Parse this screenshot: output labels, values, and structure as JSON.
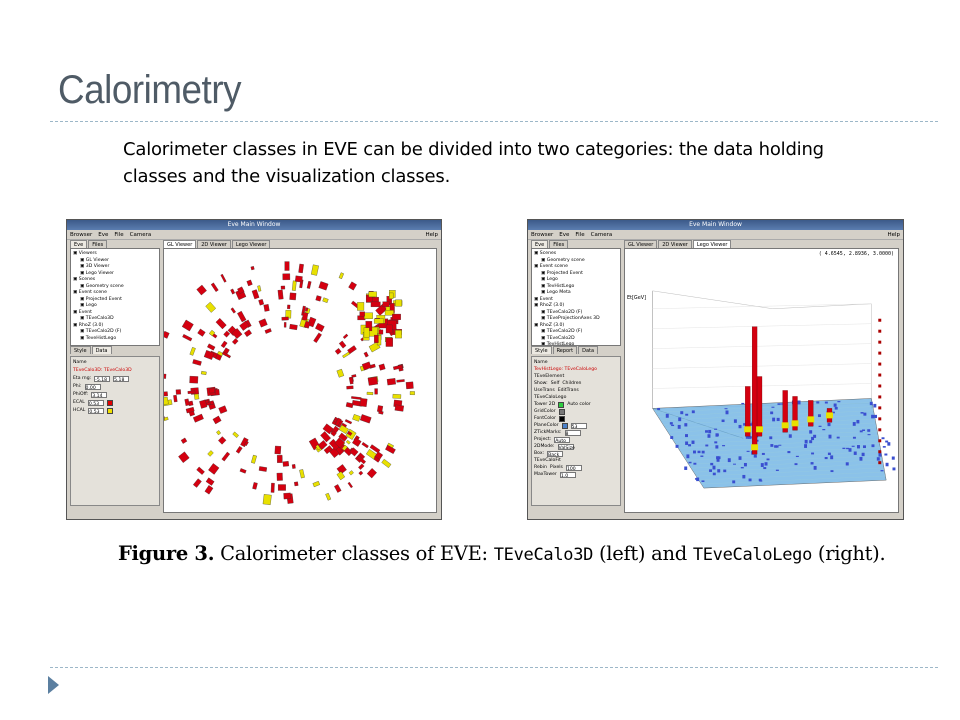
{
  "slide": {
    "title": "Calorimetry",
    "body": "Calorimeter classes in EVE can be divided into two categories: the data holding classes and the visualization classes."
  },
  "left_window": {
    "title": "Eve Main Window",
    "menu": [
      "Browser",
      "Eve",
      "File",
      "Camera"
    ],
    "help": "Help",
    "left_tabs": [
      "Eve",
      "Files"
    ],
    "viewer_tabs": [
      "GL Viewer",
      "2D Viewer",
      "Lego Viewer"
    ],
    "tree": [
      "Viewers",
      "GL Viewer",
      "3D Viewer",
      "Lego Viewer",
      "Scenes",
      "Geometry scene",
      "Event scene",
      "Projected Event",
      "Lego",
      "Event",
      "TEveCalo3D",
      "RhoZ (3.0)",
      "TEveCalo2D (F)",
      "TeveHistLego"
    ],
    "editor_tabs": [
      "Style",
      "Data"
    ],
    "editor": {
      "name_label": "Name",
      "name_value": "TEveCalo3D: TEveCalo3D",
      "eta_label": "Eta rng:",
      "eta_min": "-5.18",
      "eta_max": "5.18",
      "phi_label": "Phi:",
      "phi_value": "0.00",
      "phioff_label": "PhiOff:",
      "phioff_value": "3.14",
      "ecal_label": "ECAL",
      "ecal_value": "0.53",
      "hcal_label": "HCAL",
      "hcal_value": "0.53",
      "ecal_color": "#e00000",
      "hcal_color": "#f0e000"
    }
  },
  "right_window": {
    "title": "Eve Main Window",
    "menu": [
      "Browser",
      "Eve",
      "File",
      "Camera"
    ],
    "help": "Help",
    "left_tabs": [
      "Eve",
      "Files"
    ],
    "viewer_tabs": [
      "GL Viewer",
      "2D Viewer",
      "Lego Viewer"
    ],
    "coord": "( 4.6545, 2.8936, 3.0000)",
    "y_axis_label": "Et[GeV]",
    "tree": [
      "Scenes",
      "Geometry scene",
      "Event scene",
      "Projected Event",
      "Lego",
      "TevHistLego",
      "Lego Meta",
      "Event",
      "RhoZ (3.0)",
      "TEveCalo2D (F)",
      "TEveProjectionAxes 3D",
      "RhoZ (3.0)",
      "TEveCalo2D (F)",
      "TEveCalo2D",
      "TevHistLego"
    ],
    "editor_tabs": [
      "Style",
      "Report",
      "Data"
    ],
    "editor": {
      "name_label": "Name",
      "name_value": "TevHistLego: TEveCaloLego",
      "elem_label": "TEveElement",
      "show_label": "Show:",
      "self_label": "Self",
      "children_label": "Children",
      "useframe_label": "UseTrans",
      "edittrans_label": "EditTrans",
      "lego_label": "TEveCaloLego",
      "tower_label": "Tower 2D",
      "autocolor_label": "Auto color",
      "grid_label": "GridColor",
      "font_label": "FontColor",
      "plane_label": "PlaneColor",
      "plane_value": "53",
      "ztick_label": "ZTickMarks:",
      "ztick_value": "8",
      "project_label": "Project:",
      "project_value": "Auto",
      "2dmode_label": "2DMode:",
      "2dmode_value": "ValSize",
      "box_label": "Box:",
      "box_value": "Back",
      "calofit_label": "TEveCaloFit",
      "rebin_label": "Rebin",
      "pixels_label": "Pixels",
      "pixels_value": "100",
      "maxrows_label": "MaxTower",
      "maxrows_value": "1.0"
    }
  },
  "caption": {
    "figure": "Figure 3.",
    "text_a": " Calorimeter classes of EVE: ",
    "class_a": "TEveCalo3D",
    "text_b": " (left) and ",
    "class_b": "TEveCaloLego",
    "text_c": " (right)."
  },
  "colors": {
    "title": "#4f5b66",
    "rule": "#9db7c8",
    "tower_red": "#d40010",
    "tower_yellow": "#e8e000",
    "lego_plane": "#5aa8e0",
    "lego_towers": "#3a4fd0"
  }
}
